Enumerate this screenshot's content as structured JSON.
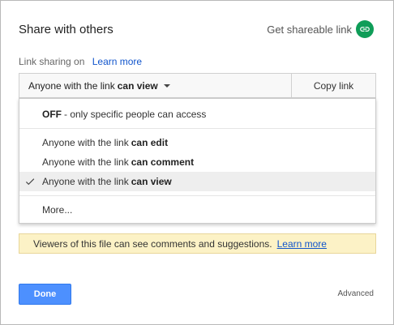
{
  "dialog": {
    "title": "Share with others",
    "get_link_label": "Get shareable link"
  },
  "sharing": {
    "label": "Link sharing on",
    "learn_more": "Learn more",
    "select_prefix": "Anyone with the link",
    "select_bold": "can view",
    "copy_label": "Copy link"
  },
  "menu": {
    "off_bold": "OFF",
    "off_rest": "- only specific people can access",
    "items": [
      {
        "prefix": "Anyone with the link",
        "bold": "can edit",
        "selected": false
      },
      {
        "prefix": "Anyone with the link",
        "bold": "can comment",
        "selected": false
      },
      {
        "prefix": "Anyone with the link",
        "bold": "can view",
        "selected": true
      }
    ],
    "more": "More..."
  },
  "info": {
    "text": "Viewers of this file can see comments and suggestions.",
    "learn_more": "Learn more"
  },
  "footer": {
    "done": "Done",
    "advanced": "Advanced"
  },
  "colors": {
    "accent_blue": "#4d90fe",
    "link_blue": "#1155cc",
    "link_icon_green": "#0f9d58",
    "info_bg": "#fcf2c6"
  },
  "icons": {
    "link": "link-icon",
    "check": "checkmark-icon",
    "dropdown": "caret-down-icon"
  }
}
